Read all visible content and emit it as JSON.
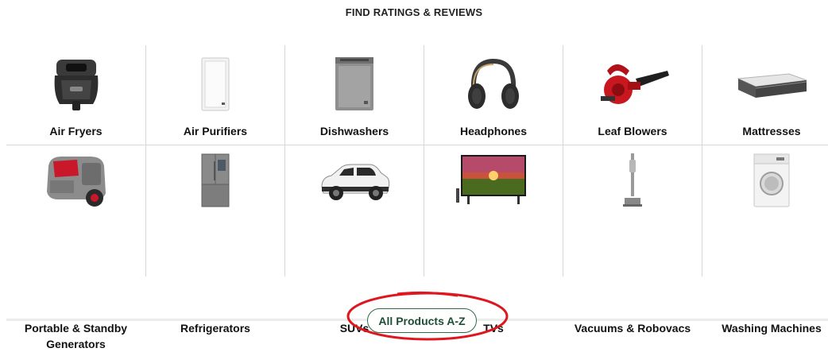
{
  "heading": "FIND RATINGS & REVIEWS",
  "categories": [
    {
      "label": "Air Fryers",
      "icon": "air-fryer-icon"
    },
    {
      "label": "Air Purifiers",
      "icon": "air-purifier-icon"
    },
    {
      "label": "Dishwashers",
      "icon": "dishwasher-icon"
    },
    {
      "label": "Headphones",
      "icon": "headphones-icon"
    },
    {
      "label": "Leaf Blowers",
      "icon": "leaf-blower-icon"
    },
    {
      "label": "Mattresses",
      "icon": "mattress-icon"
    },
    {
      "label": "Portable & Standby Generators",
      "icon": "generator-icon"
    },
    {
      "label": "Refrigerators",
      "icon": "refrigerator-icon"
    },
    {
      "label": "SUVs",
      "icon": "suv-icon"
    },
    {
      "label": "TVs",
      "icon": "tv-icon"
    },
    {
      "label": "Vacuums & Robovacs",
      "icon": "vacuum-icon"
    },
    {
      "label": "Washing Machines",
      "icon": "washing-machine-icon"
    }
  ],
  "all_products": {
    "label": "All Products A-Z"
  },
  "colors": {
    "button_border": "#2f6b4a",
    "annotation": "#e0161e",
    "divider": "#d6d6d6"
  }
}
